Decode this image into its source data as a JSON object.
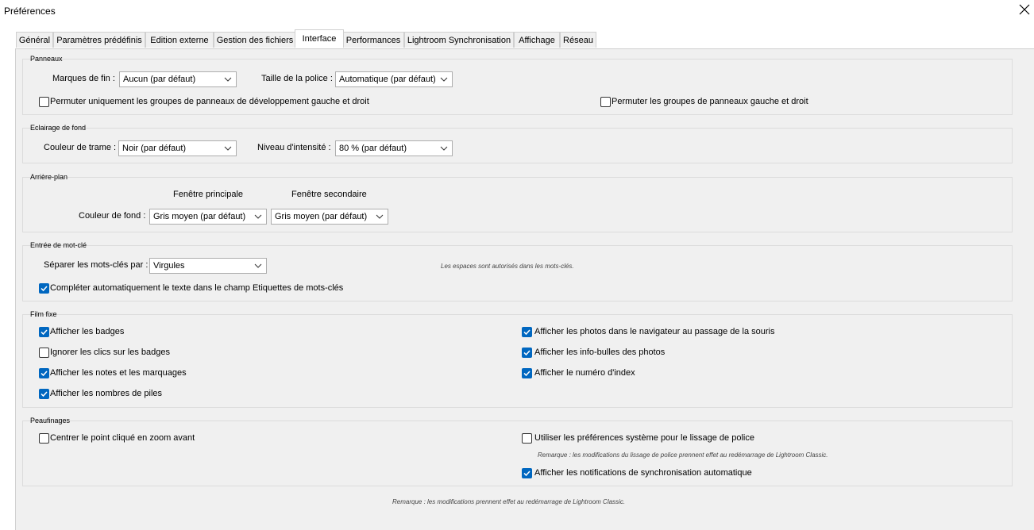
{
  "window": {
    "title": "Préférences",
    "close_icon": "close-icon"
  },
  "tabs": [
    {
      "label": "Général"
    },
    {
      "label": "Paramètres prédéfinis"
    },
    {
      "label": "Edition externe"
    },
    {
      "label": "Gestion des fichiers"
    },
    {
      "label": "Interface"
    },
    {
      "label": "Performances"
    },
    {
      "label": "Lightroom Synchronisation"
    },
    {
      "label": "Affichage"
    },
    {
      "label": "Réseau"
    }
  ],
  "active_tab": "Interface",
  "panneaux": {
    "title": "Panneaux",
    "marques_label": "Marques de fin :",
    "marques_value": "Aucun (par défaut)",
    "taille_label": "Taille de la police :",
    "taille_value": "Automatique (par défaut)",
    "permuter_dev_label": "Permuter uniquement les groupes de panneaux de développement gauche et droit",
    "permuter_dev_checked": false,
    "permuter_label": "Permuter les groupes de panneaux gauche et droit",
    "permuter_checked": false
  },
  "eclairage": {
    "title": "Eclairage de fond",
    "couleur_label": "Couleur de trame :",
    "couleur_value": "Noir (par défaut)",
    "niveau_label": "Niveau d'intensité :",
    "niveau_value": "80 % (par défaut)"
  },
  "arriere_plan": {
    "title": "Arrière-plan",
    "fenetre_principale": "Fenêtre principale",
    "fenetre_secondaire": "Fenêtre secondaire",
    "couleur_label": "Couleur de fond :",
    "principale_value": "Gris moyen (par défaut)",
    "secondaire_value": "Gris moyen (par défaut)"
  },
  "mot_cle": {
    "title": "Entrée de mot-clé",
    "separer_label": "Séparer les mots-clés par :",
    "separer_value": "Virgules",
    "note": "Les espaces sont autorisés dans les mots-clés.",
    "completer_label": "Compléter automatiquement le texte dans le champ Etiquettes de mots-clés",
    "completer_checked": true
  },
  "film_fixe": {
    "title": "Film fixe",
    "left": [
      {
        "label": "Afficher les badges",
        "checked": true
      },
      {
        "label": "Ignorer les clics sur les badges",
        "checked": false
      },
      {
        "label": "Afficher les notes et les marquages",
        "checked": true
      },
      {
        "label": "Afficher les nombres de piles",
        "checked": true
      }
    ],
    "right": [
      {
        "label": "Afficher les photos dans le navigateur au passage de la souris",
        "checked": true
      },
      {
        "label": "Afficher les info-bulles des photos",
        "checked": true
      },
      {
        "label": "Afficher le numéro d'index",
        "checked": true
      }
    ]
  },
  "peaufinages": {
    "title": "Peaufinages",
    "centrer_label": "Centrer le point cliqué en zoom avant",
    "centrer_checked": false,
    "lissage_label": "Utiliser les préférences système pour le lissage de police",
    "lissage_checked": false,
    "lissage_note": "Remarque : les modifications du lissage de police prennent effet au redémarrage de Lightroom Classic.",
    "notif_label": "Afficher les notifications de synchronisation automatique",
    "notif_checked": true
  },
  "footer_note": "Remarque : les modifications prennent effet au redémarrage de Lightroom Classic."
}
